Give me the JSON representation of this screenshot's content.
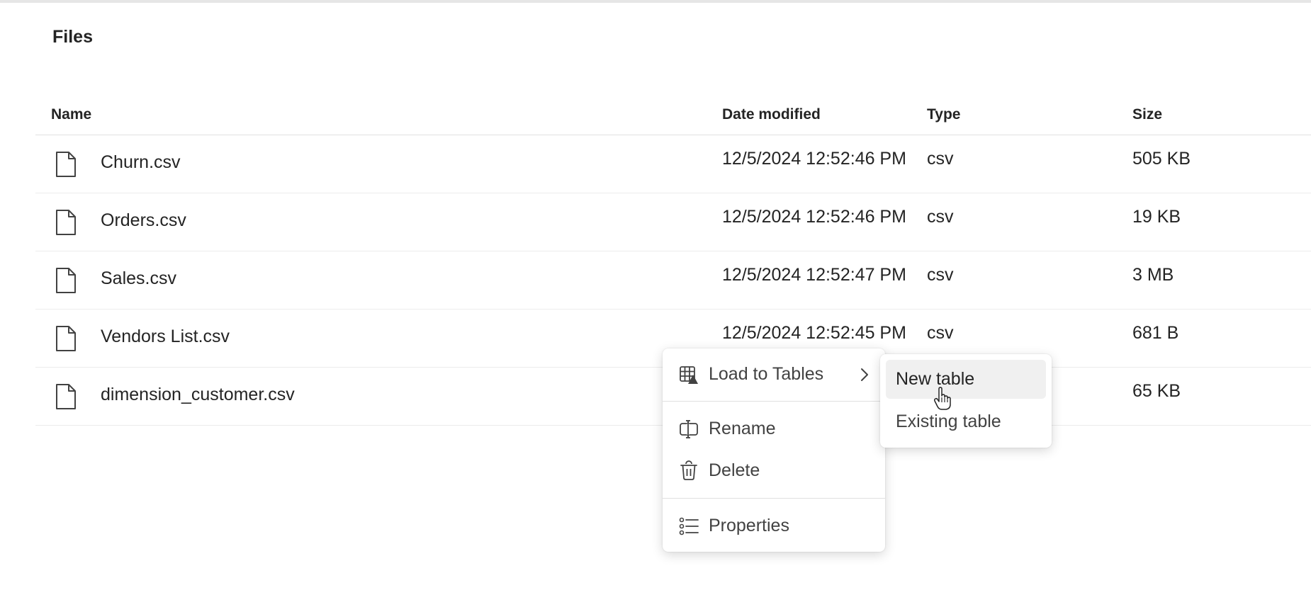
{
  "section": {
    "title": "Files"
  },
  "columns": {
    "name": "Name",
    "date": "Date modified",
    "type": "Type",
    "size": "Size"
  },
  "files": [
    {
      "name": "Churn.csv",
      "date": "12/5/2024 12:52:46 PM",
      "type": "csv",
      "size": "505 KB",
      "icon": "file-icon"
    },
    {
      "name": "Orders.csv",
      "date": "12/5/2024 12:52:46 PM",
      "type": "csv",
      "size": "19 KB",
      "icon": "file-icon"
    },
    {
      "name": "Sales.csv",
      "date": "12/5/2024 12:52:47 PM",
      "type": "csv",
      "size": "3 MB",
      "icon": "file-icon"
    },
    {
      "name": "Vendors List.csv",
      "date": "12/5/2024 12:52:45 PM",
      "type": "csv",
      "size": "681 B",
      "icon": "file-icon"
    },
    {
      "name": "dimension_customer.csv",
      "date": "",
      "type": "",
      "size": "65 KB",
      "icon": "file-icon"
    }
  ],
  "context_menu": {
    "load_to_tables": {
      "label": "Load to Tables",
      "icon": "table-load-icon"
    },
    "rename": {
      "label": "Rename",
      "icon": "rename-icon"
    },
    "delete": {
      "label": "Delete",
      "icon": "trash-icon"
    },
    "properties": {
      "label": "Properties",
      "icon": "list-icon"
    }
  },
  "submenu": {
    "new_table": "New table",
    "existing_table": "Existing table"
  },
  "colors": {
    "text": "#242424",
    "menu_text": "#424242",
    "hover_bg": "#f0f0f0",
    "divider": "#e0e0e0"
  }
}
